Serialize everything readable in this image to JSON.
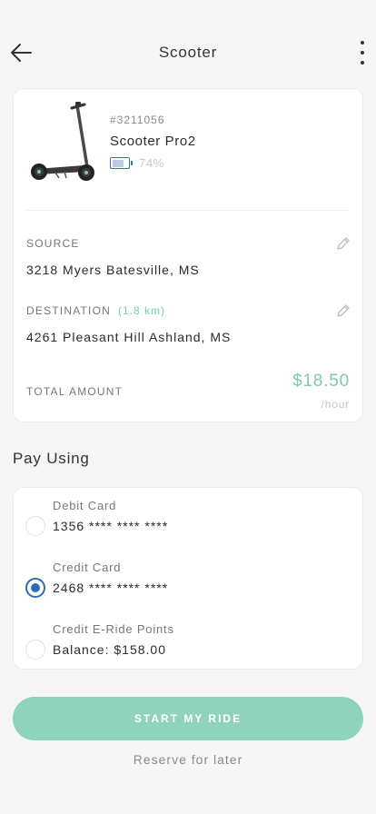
{
  "header": {
    "title": "Scooter",
    "back_icon": "arrow-left-icon",
    "more_icon": "more-vertical-icon"
  },
  "scooter": {
    "id": "#3211056",
    "name": "Scooter Pro2",
    "battery_text": "74%",
    "battery_level": 0.74
  },
  "trip": {
    "source_label": "SOURCE",
    "source_value": "3218 Myers Batesville, MS",
    "destination_label": "DESTINATION",
    "destination_distance": "(1.8 km)",
    "destination_value": "4261 Pleasant Hill Ashland, MS",
    "total_label": "TOTAL AMOUNT",
    "total_value": "$18.50",
    "total_unit": "/hour"
  },
  "payment": {
    "section_title": "Pay Using",
    "options": [
      {
        "name": "Debit Card",
        "detail": "1356 **** **** ****",
        "selected": false
      },
      {
        "name": "Credit Card",
        "detail": "2468 **** **** ****",
        "selected": true
      },
      {
        "name": "Credit E-Ride Points",
        "detail": "Balance: $158.00",
        "selected": false
      }
    ]
  },
  "actions": {
    "start_label": "START MY RIDE",
    "reserve_label": "Reserve for later"
  },
  "colors": {
    "accent": "#7dcaaf",
    "button": "#8fd3bc",
    "selected": "#2d6cb3",
    "background": "#f6f6f6"
  }
}
